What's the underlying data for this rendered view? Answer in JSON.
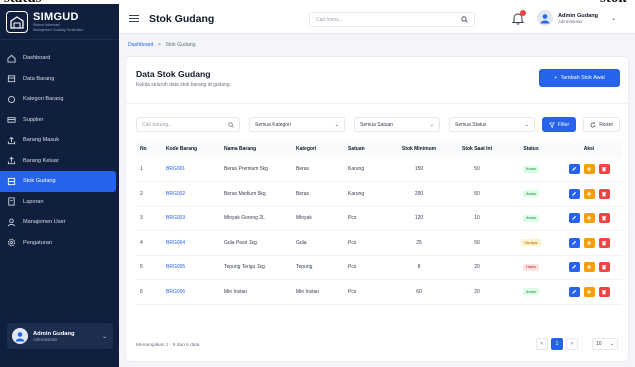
{
  "top_slice": {
    "left_text": "status",
    "right_text": "stok"
  },
  "brand": {
    "name": "SIMGUD",
    "subtitle_line1": "Sistem Informasi",
    "subtitle_line2": "Manajemen Gudang Terstruktur"
  },
  "sidebar": {
    "items": [
      {
        "label": "Dashboard",
        "icon": "home-icon",
        "active": false
      },
      {
        "label": "Data Barang",
        "icon": "box-icon",
        "active": false
      },
      {
        "label": "Kategori Barang",
        "icon": "tag-icon",
        "active": false
      },
      {
        "label": "Supplier",
        "icon": "truck-icon",
        "active": false
      },
      {
        "label": "Barang Masuk",
        "icon": "upload-icon",
        "active": false
      },
      {
        "label": "Barang Keluar",
        "icon": "upload-icon",
        "active": false
      },
      {
        "label": "Stok Gudang",
        "icon": "grid-icon",
        "active": true
      },
      {
        "label": "Laporan",
        "icon": "file-icon",
        "active": false
      },
      {
        "label": "Manajemen User",
        "icon": "user-icon",
        "active": false
      },
      {
        "label": "Pengaturan",
        "icon": "gear-icon",
        "active": false
      }
    ],
    "user": {
      "name": "Admin Gudang",
      "role": "Administrator"
    }
  },
  "header": {
    "title": "Stok Gudang",
    "search_placeholder": "Cari menu...",
    "user": {
      "name": "Admin Gudang",
      "role": "Administrator"
    }
  },
  "breadcrumb": {
    "root": "Dashboard",
    "separator": ">",
    "current": "Stok Gudang"
  },
  "card": {
    "title": "Data Stok Gudang",
    "subtitle": "Kelola seluruh data stok barang di gudang.",
    "add_button": "Tambah Stok Awal"
  },
  "filters": {
    "search_placeholder": "Cari barang...",
    "kategori": "Semua Kategori",
    "satuan": "Semua Satuan",
    "status": "Semua Status",
    "filter_button": "Filter",
    "reset_button": "Reset"
  },
  "table": {
    "headers": [
      "No",
      "Kode Barang",
      "Nama Barang",
      "Kategori",
      "Satuan",
      "Stok Minimum",
      "Stok Saat Ini",
      "Status",
      "Aksi"
    ],
    "rows": [
      {
        "no": "1",
        "kode": "BRG001",
        "nama": "Beras Premium 5kg",
        "kategori": "Beras",
        "satuan": "Karung",
        "stok_min": "150",
        "stok_now": "50",
        "status": "Aman",
        "status_type": "aman"
      },
      {
        "no": "2",
        "kode": "BRG002",
        "nama": "Beras Medium 5kg",
        "kategori": "Beras",
        "satuan": "Karung",
        "stok_min": "200",
        "stok_now": "50",
        "status": "Aman",
        "status_type": "aman"
      },
      {
        "no": "3",
        "kode": "BRG003",
        "nama": "Minyak Goreng 2L",
        "kategori": "Minyak",
        "satuan": "Pcs",
        "stok_min": "120",
        "stok_now": "10",
        "status": "Aman",
        "status_type": "aman"
      },
      {
        "no": "4",
        "kode": "BRG004",
        "nama": "Gula Pasir 1kg",
        "kategori": "Gula",
        "satuan": "Pcs",
        "stok_min": "25",
        "stok_now": "50",
        "status": "Menipis",
        "status_type": "menipis"
      },
      {
        "no": "5",
        "kode": "BRG005",
        "nama": "Tepung Terigu 1kg",
        "kategori": "Tepung",
        "satuan": "Pcs",
        "stok_min": "8",
        "stok_now": "20",
        "status": "Habis",
        "status_type": "habis"
      },
      {
        "no": "6",
        "kode": "BRG006",
        "nama": "Mie Instan",
        "kategori": "Mie Instan",
        "satuan": "Pcs",
        "stok_min": "60",
        "stok_now": "20",
        "status": "Aman",
        "status_type": "aman"
      }
    ]
  },
  "pagination": {
    "info": "Menampilkan 1 - 6 dari 6 data",
    "prev": "<",
    "current": "1",
    "next": ">",
    "per_page": "10"
  },
  "colors": {
    "sidebar": "#0f1f3d",
    "accent": "#2563eb",
    "warning": "#f59e0b",
    "danger": "#ef4444"
  }
}
